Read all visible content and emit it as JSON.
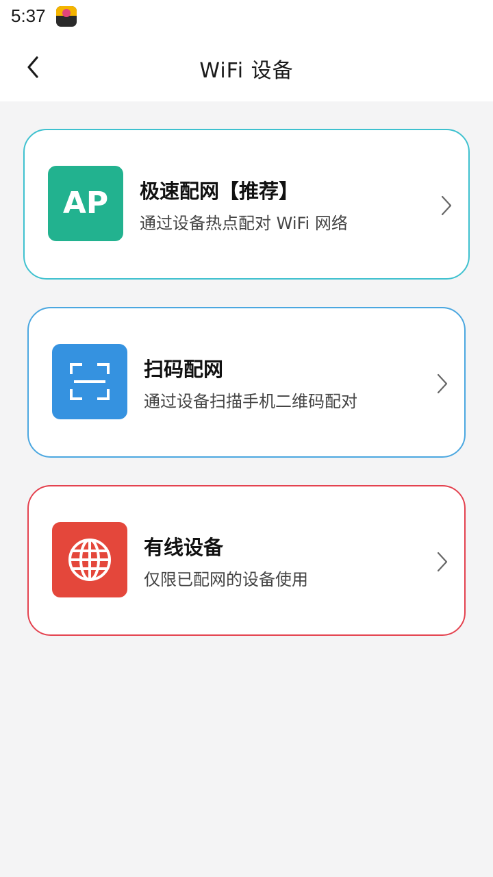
{
  "status_bar": {
    "time": "5:37",
    "app_icon": "notification-app-icon"
  },
  "header": {
    "back_icon": "chevron-left-icon",
    "title": "WiFi 设备"
  },
  "options": [
    {
      "icon": "ap-icon",
      "icon_text": "AP",
      "icon_color": "#22b28f",
      "border_color": "#3ec1cf",
      "title": "极速配网【推荐】",
      "subtitle": "通过设备热点配对 WiFi 网络"
    },
    {
      "icon": "scan-frame-icon",
      "icon_color": "#3592e0",
      "border_color": "#4ba7e0",
      "title": "扫码配网",
      "subtitle": "通过设备扫描手机二维码配对"
    },
    {
      "icon": "globe-icon",
      "icon_color": "#e4473b",
      "border_color": "#e4424f",
      "title": "有线设备",
      "subtitle": "仅限已配网的设备使用"
    }
  ],
  "chevron_icon": "chevron-right-icon"
}
